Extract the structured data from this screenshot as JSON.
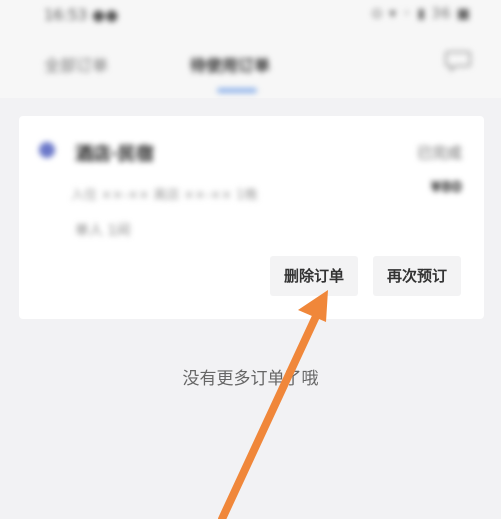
{
  "status_bar": {
    "time": "16:53 ●●",
    "indicators": "⊙ ▾ ◦ ▮ 36 ■"
  },
  "tabs": [
    {
      "label": "全部订单"
    },
    {
      "label": "待使用订单"
    }
  ],
  "order": {
    "hotel_name": "酒店·民宿",
    "status": "已完成",
    "detail": "入住 ××-××  离店 ××-××  1晚",
    "price": "¥80",
    "room": "单人 1间",
    "buttons": {
      "delete": "删除订单",
      "rebook": "再次预订"
    }
  },
  "footer_text": "没有更多订单了哦",
  "colors": {
    "accent": "#8fb3ea",
    "hotel_icon": "#6b78c9",
    "arrow": "#f0873a"
  }
}
